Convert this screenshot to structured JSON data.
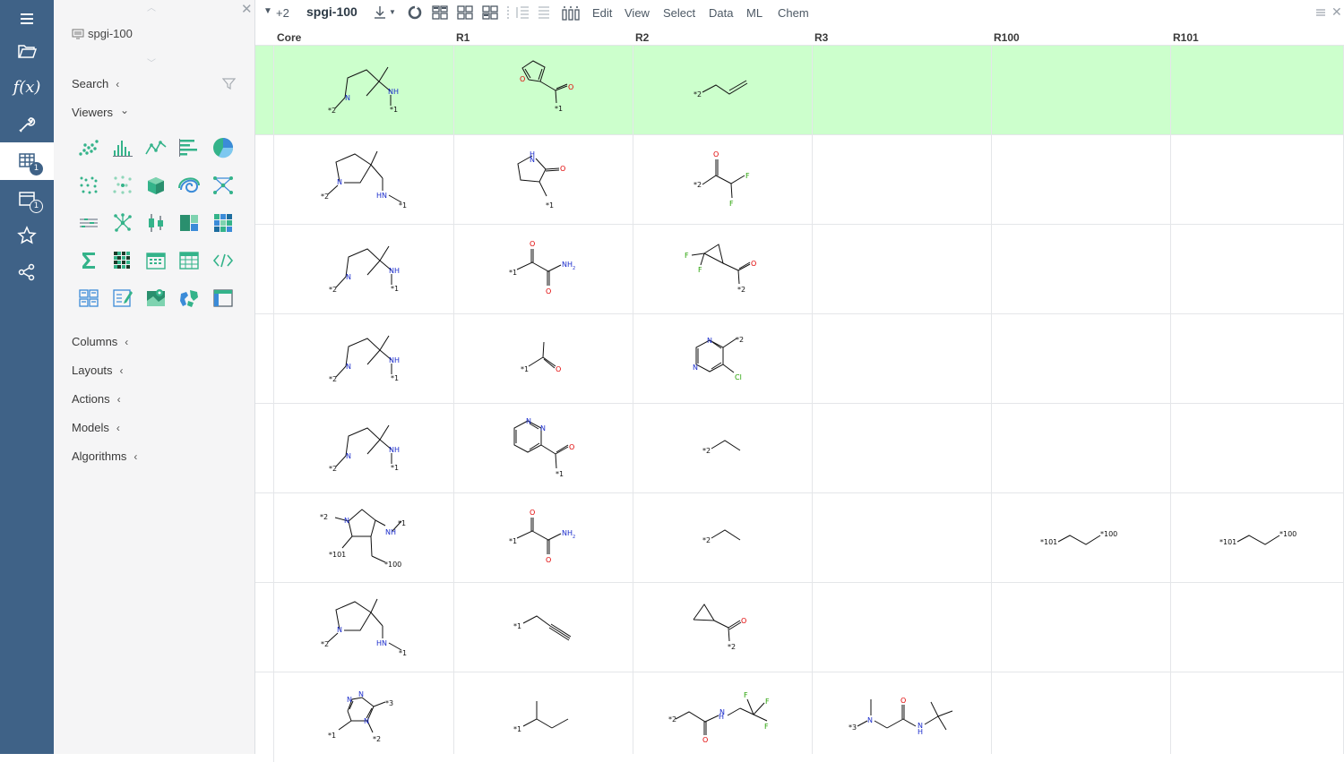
{
  "rail": {
    "items": [
      {
        "name": "menu",
        "badge": ""
      },
      {
        "name": "open",
        "badge": ""
      },
      {
        "name": "functions",
        "badge": ""
      },
      {
        "name": "tools",
        "badge": ""
      },
      {
        "name": "tables",
        "badge": "1"
      },
      {
        "name": "views",
        "badge": "1"
      },
      {
        "name": "favorites",
        "badge": ""
      },
      {
        "name": "share",
        "badge": ""
      }
    ],
    "fx_label": "f(x)"
  },
  "toolbox": {
    "table_name": "spgi-100",
    "sections": {
      "search": "Search",
      "viewers": "Viewers",
      "columns": "Columns",
      "layouts": "Layouts",
      "actions": "Actions",
      "models": "Models",
      "algorithms": "Algorithms"
    },
    "arrows": {
      "collapsed": "‹",
      "expanded": "⌄"
    }
  },
  "toolbar": {
    "plus_count": "+2",
    "table_title": "spgi-100",
    "menus": [
      "Edit",
      "View",
      "Select",
      "Data",
      "ML",
      "Chem"
    ]
  },
  "grid": {
    "columns": [
      "Core",
      "R1",
      "R2",
      "R3",
      "R100",
      "R101"
    ],
    "selected_row": 0,
    "colors": {
      "selected_row": "#ccffcc",
      "nitrogen": "#1b2ccc",
      "oxygen": "#e00000",
      "halogen": "#23a000"
    },
    "labels": {
      "nh": "NH",
      "hn": "HN",
      "n": "N",
      "o": "O",
      "f": "F",
      "cl": "Cl",
      "nh2": "NH",
      "h": "H",
      "r1": "*1",
      "r2": "*2",
      "r3": "*3",
      "r100": "*100",
      "r101": "*101"
    }
  }
}
